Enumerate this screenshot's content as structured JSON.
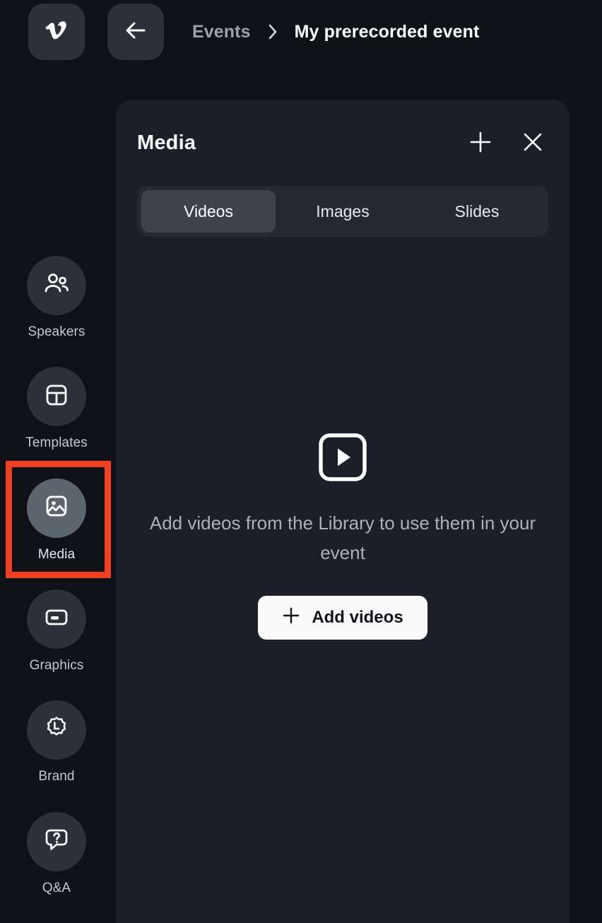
{
  "topbar": {
    "logo_icon": "vimeo-logo-icon",
    "back_icon": "arrow-left-icon",
    "breadcrumb": {
      "parent": "Events",
      "separator_icon": "chevron-right-icon",
      "current": "My prerecorded event"
    }
  },
  "sidebar": {
    "items": [
      {
        "label": "Speakers",
        "icon": "speakers-icon",
        "active": false
      },
      {
        "label": "Templates",
        "icon": "templates-icon",
        "active": false
      },
      {
        "label": "Media",
        "icon": "media-image-icon",
        "active": true
      },
      {
        "label": "Graphics",
        "icon": "graphics-icon",
        "active": false
      },
      {
        "label": "Brand",
        "icon": "brand-badge-icon",
        "active": false
      },
      {
        "label": "Q&A",
        "icon": "qa-bubble-icon",
        "active": false
      }
    ],
    "highlight": {
      "target": "Media",
      "color": "#f0401f"
    }
  },
  "panel": {
    "title": "Media",
    "add_icon": "plus-icon",
    "close_icon": "close-icon",
    "tabs": [
      {
        "label": "Videos",
        "active": true
      },
      {
        "label": "Images",
        "active": false
      },
      {
        "label": "Slides",
        "active": false
      }
    ],
    "empty_state": {
      "icon": "video-play-icon",
      "message": "Add videos from the Library to use them in your event",
      "button_label": "Add videos",
      "button_icon": "plus-icon"
    }
  },
  "colors": {
    "page_background": "#0e1115",
    "panel_background": "#1b1f27",
    "rail_circle": "#2b3138",
    "rail_circle_active": "#5c656e",
    "tab_track": "#242932",
    "tab_active": "#3c434d",
    "accent_highlight": "#f0401f",
    "primary_button": "#fafafa",
    "muted_text": "#a9b1b9"
  }
}
